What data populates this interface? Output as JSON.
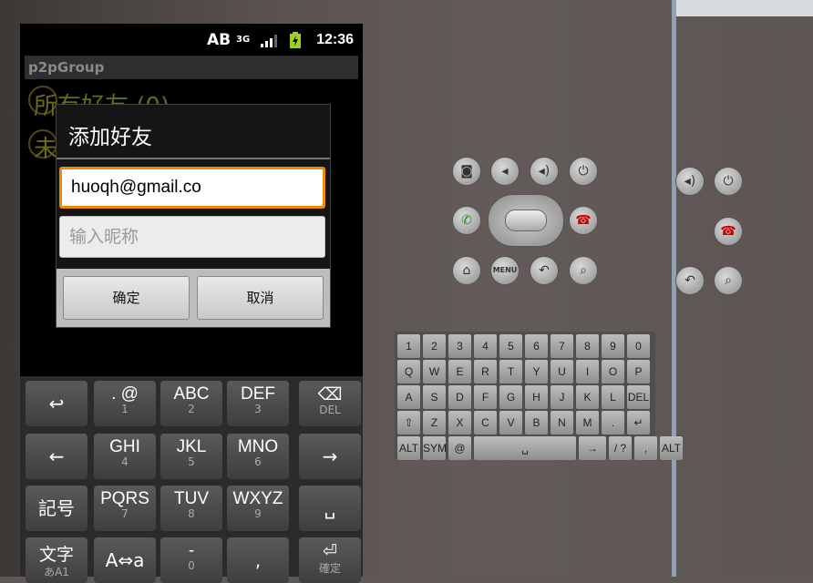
{
  "status_bar": {
    "ab": "AB",
    "network": "3G",
    "time": "12:36"
  },
  "app": {
    "title": "p2pGroup",
    "list_item_1": "所有好友 (0)",
    "list_item_2": "未"
  },
  "dialog": {
    "title": "添加好友",
    "email_value": "huoqh@gmail.co",
    "nickname_placeholder": "输入昵称",
    "ok_label": "确定",
    "cancel_label": "取消"
  },
  "keyboard": {
    "rows": [
      [
        {
          "main": "↩",
          "sub": ""
        },
        {
          "main": ". @",
          "sub": "1"
        },
        {
          "main": "ABC",
          "sub": "2"
        },
        {
          "main": "DEF",
          "sub": "3"
        },
        {
          "main": "⌫",
          "sub": "DEL"
        }
      ],
      [
        {
          "main": "←",
          "sub": ""
        },
        {
          "main": "GHI",
          "sub": "4"
        },
        {
          "main": "JKL",
          "sub": "5"
        },
        {
          "main": "MNO",
          "sub": "6"
        },
        {
          "main": "→",
          "sub": ""
        }
      ],
      [
        {
          "main": "記号",
          "sub": ""
        },
        {
          "main": "PQRS",
          "sub": "7"
        },
        {
          "main": "TUV",
          "sub": "8"
        },
        {
          "main": "WXYZ",
          "sub": "9"
        },
        {
          "main": "␣",
          "sub": ""
        }
      ],
      [
        {
          "main": "文字",
          "sub": "あA1"
        },
        {
          "main": "A⇔a",
          "sub": ""
        },
        {
          "main": "-",
          "sub": "0"
        },
        {
          "main": ",",
          "sub": ""
        },
        {
          "main": "⏎",
          "sub": "確定"
        }
      ]
    ]
  },
  "emulator_controls": {
    "row1": [
      "camera-icon",
      "volume-down-icon",
      "volume-up-icon",
      "power-icon"
    ],
    "row2": [
      "call-icon",
      "dpad",
      "end-call-icon"
    ],
    "row3": [
      "home-icon",
      "MENU",
      "back-icon",
      "search-icon"
    ]
  },
  "qwerty": {
    "row1": [
      "1",
      "2",
      "3",
      "4",
      "5",
      "6",
      "7",
      "8",
      "9",
      "0"
    ],
    "row2": [
      "Q",
      "W",
      "E",
      "R",
      "T",
      "Y",
      "U",
      "I",
      "O",
      "P"
    ],
    "row3": [
      "A",
      "S",
      "D",
      "F",
      "G",
      "H",
      "J",
      "K",
      "L",
      "DEL"
    ],
    "row4": [
      "⇧",
      "Z",
      "X",
      "C",
      "V",
      "B",
      "N",
      "M",
      ".",
      "↵"
    ],
    "row5": [
      "ALT",
      "SYM",
      "@",
      "␣",
      "→",
      "/ ?",
      ",",
      "ALT"
    ]
  },
  "colors": {
    "focus_border": "#f08a00",
    "accent_text": "#6b6a10"
  }
}
